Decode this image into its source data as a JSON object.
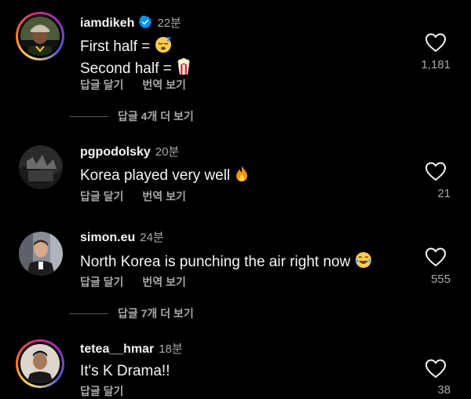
{
  "comments": [
    {
      "username": "iamdikeh",
      "time": "22분",
      "verified": true,
      "lines": [
        "First half = ",
        "Second half = "
      ],
      "emojis": [
        "sleepy-face-emoji",
        "popcorn-emoji"
      ],
      "actions": [
        "답글 달기",
        "번역 보기"
      ],
      "likes": "1,181"
    },
    {
      "username": "pgpodolsky",
      "time": "20분",
      "lines": [
        "Korea played very well "
      ],
      "emojis": [
        "fire-emoji"
      ],
      "actions": [
        "답글 달기",
        "번역 보기"
      ],
      "likes": "21"
    },
    {
      "username": "simon.eu",
      "time": "24분",
      "lines": [
        "North Korea is punching the air right now "
      ],
      "emojis": [
        "tears-of-joy-emoji"
      ],
      "actions": [
        "답글 달기",
        "번역 보기"
      ],
      "likes": "555"
    },
    {
      "username": "tetea__hmar",
      "time": "18분",
      "lines": [
        "It's K Drama!!"
      ],
      "actions": [
        "답글 달기"
      ],
      "likes": "38"
    }
  ],
  "replies": [
    {
      "label": "답글 4개 더 보기"
    },
    {
      "label": "답글 7개 더 보기"
    }
  ],
  "colors": {
    "background": "#000000",
    "text": "#f5f5f5",
    "secondary": "#a8a8a8",
    "verified": "#0095f6"
  }
}
